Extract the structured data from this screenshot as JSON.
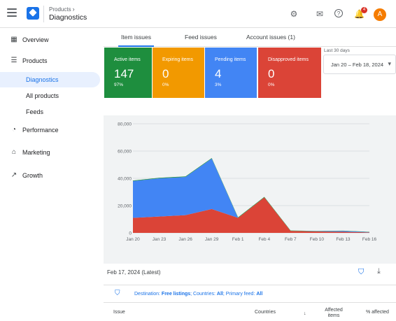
{
  "header": {
    "breadcrumb": "Products",
    "title": "Diagnostics",
    "notifications": "4",
    "avatar_letter": "A"
  },
  "sidebar": {
    "items": [
      {
        "label": "Overview",
        "icon": "overview-icon"
      },
      {
        "label": "Products",
        "icon": "products-icon"
      },
      {
        "label": "Diagnostics",
        "icon": ""
      },
      {
        "label": "All products",
        "icon": ""
      },
      {
        "label": "Feeds",
        "icon": ""
      },
      {
        "label": "Performance",
        "icon": "performance-icon"
      },
      {
        "label": "Marketing",
        "icon": "marketing-icon"
      },
      {
        "label": "Growth",
        "icon": "growth-icon"
      }
    ]
  },
  "tabs": [
    "Item issues",
    "Feed issues",
    "Account issues (1)"
  ],
  "cards": [
    {
      "title": "Active items",
      "value": "147",
      "pct": "97%",
      "color": "#1e8e3e"
    },
    {
      "title": "Expiring items",
      "value": "0",
      "pct": "0%",
      "color": "#f29900"
    },
    {
      "title": "Pending items",
      "value": "4",
      "pct": "3%",
      "color": "#4285f4"
    },
    {
      "title": "Disapproved items",
      "value": "0",
      "pct": "0%",
      "color": "#db4437"
    }
  ],
  "date_range": {
    "label": "Last 30 days",
    "value": "Jan 20 – Feb 18, 2024"
  },
  "chart_data": {
    "type": "area",
    "x": [
      "Jan 20",
      "Jan 23",
      "Jan 26",
      "Jan 29",
      "Feb 1",
      "Feb 4",
      "Feb 7",
      "Feb 10",
      "Feb 13",
      "Feb 16"
    ],
    "yticks": [
      "80,000",
      "60,000",
      "40,000",
      "20,000",
      "0"
    ],
    "ylim": [
      0,
      80000
    ],
    "grid": true,
    "series": [
      {
        "name": "",
        "color": "#db4437",
        "values": [
          11000,
          12000,
          13000,
          17500,
          11000,
          26000,
          1500,
          1000,
          800,
          300
        ]
      },
      {
        "name": "",
        "color": "#4285f4",
        "values": [
          27000,
          28000,
          28000,
          37000,
          0,
          0,
          0,
          200,
          600,
          300
        ]
      },
      {
        "name": "",
        "color": "#1e8e3e",
        "values": [
          400,
          400,
          400,
          400,
          400,
          400,
          200,
          200,
          200,
          200
        ]
      }
    ]
  },
  "report": {
    "date": "Feb 17, 2024 (Latest)",
    "filter_prefix": "Destination:",
    "filter_dest": "Free listings",
    "filter_countries_label": "; Countries:",
    "filter_countries": "All",
    "filter_feed_label": "; Primary feed:",
    "filter_feed": "All"
  },
  "table": {
    "columns": [
      "Issue",
      "Countries",
      "Affected items",
      "% affected"
    ]
  }
}
